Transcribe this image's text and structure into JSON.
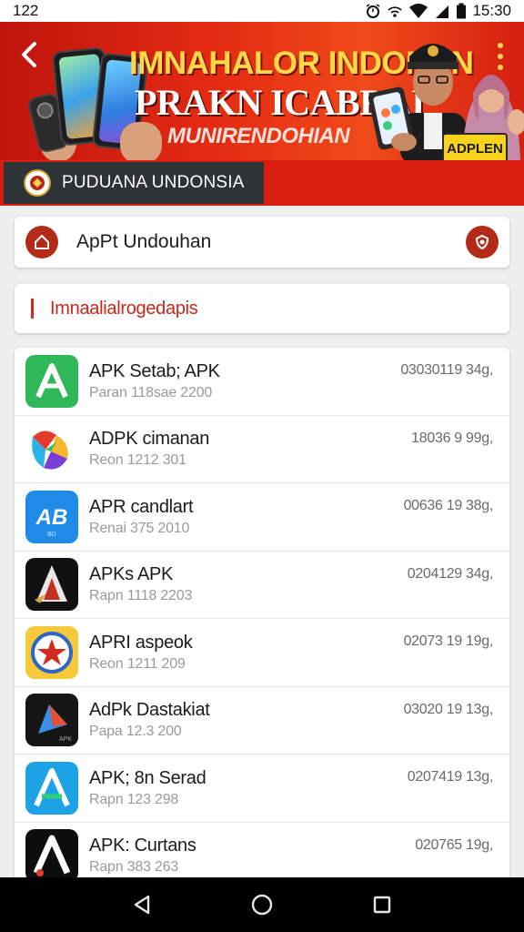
{
  "status_bar": {
    "time_left": "122",
    "time_right": "15:30"
  },
  "banner": {
    "line1": "IMNAHALOR INDONAN",
    "line2": "PRAKN ICABRAI",
    "line3": "MUNIRENDOHIAN",
    "badge": "ADPLEN"
  },
  "ministry": {
    "label": "PUDUANA UNDONSIA"
  },
  "title_card": {
    "title": "ApPt Undouhan"
  },
  "filter": {
    "label": "Imnaalialrogedapis"
  },
  "apps": [
    {
      "name": "APK Setab; APK",
      "meta": "Paran 118sae 2200",
      "size": "03030119 34g,",
      "icon": "green-a-icon"
    },
    {
      "name": "ADPK cimanan",
      "meta": "Reon 1212 301",
      "size": "18036 9 99g,",
      "icon": "colorful-swirl-icon"
    },
    {
      "name": "APR candlart",
      "meta": "Renai 375 2010",
      "size": "00636 19 38g,",
      "icon": "blue-ab-icon"
    },
    {
      "name": "APKs APK",
      "meta": "Rapn 1118 2203",
      "size": "0204129 34g,",
      "icon": "black-a-icon"
    },
    {
      "name": "APRI aspeok",
      "meta": "Reon 1211 209",
      "size": "02073 19 19g,",
      "icon": "star-emblem-icon"
    },
    {
      "name": "AdPk Dastakiat",
      "meta": "Papa 12.3 200",
      "size": "03020 19 13g,",
      "icon": "dark-triangle-icon"
    },
    {
      "name": "APK; 8n Serad",
      "meta": "Rapn 123 298",
      "size": "0207419 13g,",
      "icon": "blue-a-icon"
    },
    {
      "name": "APK: Curtans",
      "meta": "Rapn 383 263",
      "size": "020765 19g,",
      "icon": "white-a-icon"
    }
  ]
}
